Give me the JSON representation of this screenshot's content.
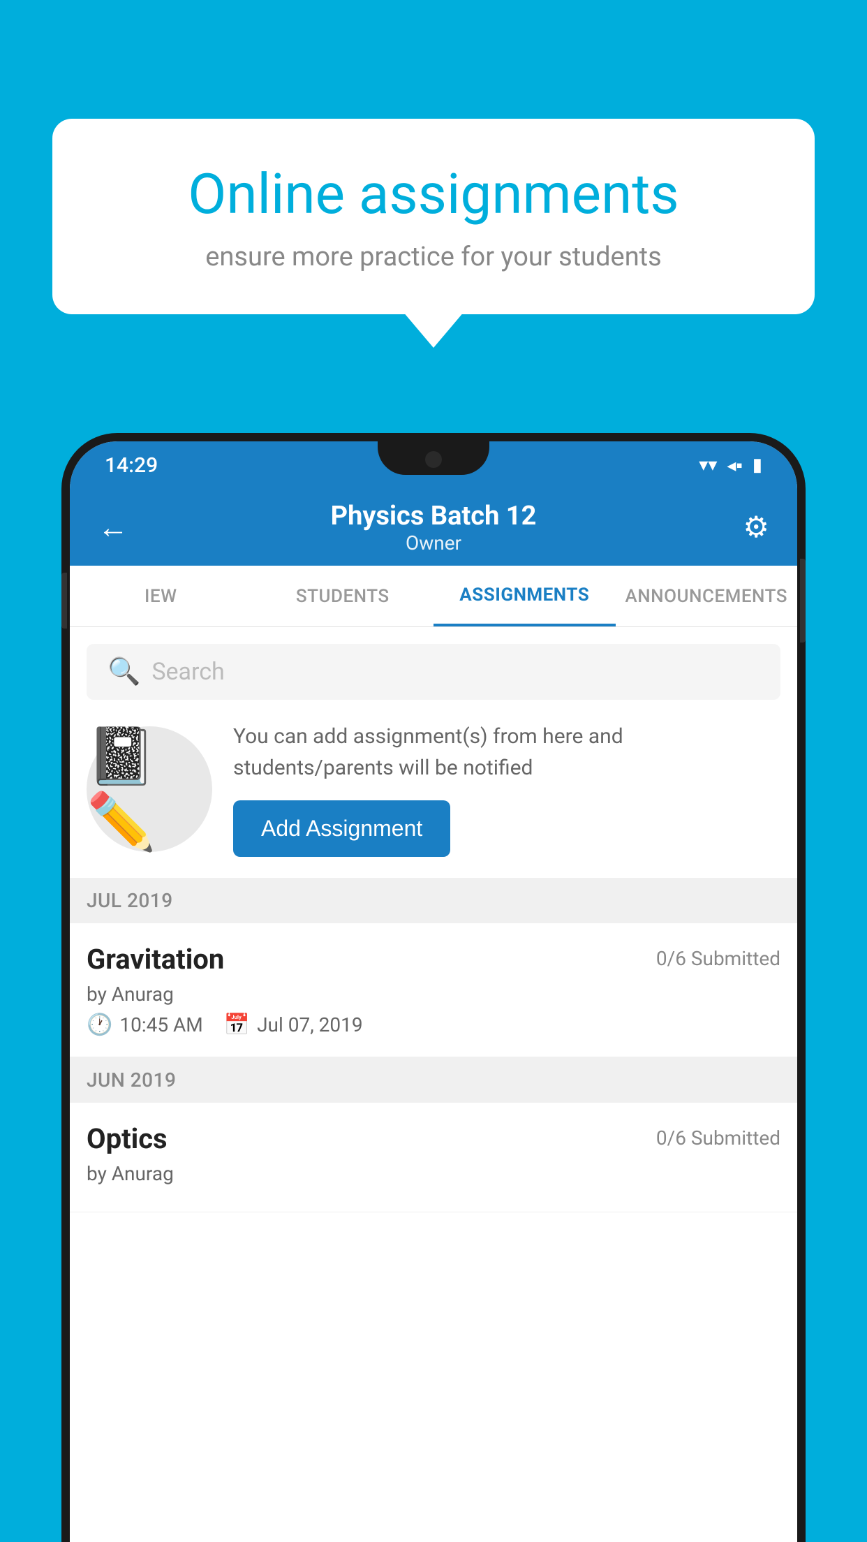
{
  "background_color": "#00AEDC",
  "speech_bubble": {
    "title": "Online assignments",
    "subtitle": "ensure more practice for your students"
  },
  "status_bar": {
    "time": "14:29",
    "wifi_icon": "▼",
    "signal_icon": "◀",
    "battery_icon": "▮"
  },
  "header": {
    "title": "Physics Batch 12",
    "subtitle": "Owner",
    "back_label": "←",
    "settings_label": "⚙"
  },
  "tabs": [
    {
      "id": "iew",
      "label": "IEW",
      "active": false
    },
    {
      "id": "students",
      "label": "STUDENTS",
      "active": false
    },
    {
      "id": "assignments",
      "label": "ASSIGNMENTS",
      "active": true
    },
    {
      "id": "announcements",
      "label": "ANNOUNCEMENTS",
      "active": false
    }
  ],
  "search": {
    "placeholder": "Search"
  },
  "promo": {
    "description": "You can add assignment(s) from here and students/parents will be notified",
    "button_label": "Add Assignment"
  },
  "sections": [
    {
      "month": "JUL 2019",
      "assignments": [
        {
          "name": "Gravitation",
          "submitted": "0/6 Submitted",
          "by": "by Anurag",
          "time": "10:45 AM",
          "date": "Jul 07, 2019"
        }
      ]
    },
    {
      "month": "JUN 2019",
      "assignments": [
        {
          "name": "Optics",
          "submitted": "0/6 Submitted",
          "by": "by Anurag",
          "time": "",
          "date": ""
        }
      ]
    }
  ]
}
